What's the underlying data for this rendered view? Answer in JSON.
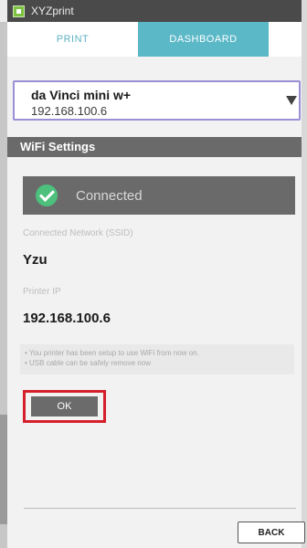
{
  "window": {
    "title": "XYZprint"
  },
  "tabs": [
    {
      "label": "PRINT",
      "active": false
    },
    {
      "label": "DASHBOARD",
      "active": true
    }
  ],
  "printer_select": {
    "name": "da Vinci mini w+",
    "ip": "192.168.100.6"
  },
  "wifi_settings": {
    "header": "WiFi Settings",
    "status": "Connected",
    "ssid_label": "Connected Network (SSID)",
    "ssid_value": "Yzu",
    "printer_ip_label": "Printer IP",
    "printer_ip_value": "192.168.100.6",
    "notes": [
      "• You printer has been setup to use WiFi from now on.",
      "• USB cable can be safely remove now"
    ],
    "ok_label": "OK"
  },
  "footer": {
    "back_label": "BACK"
  },
  "colors": {
    "accent": "#5bb8c7",
    "success": "#4ec07d",
    "highlight_outline": "#d61f2b",
    "section_bar": "#6a6a6a"
  },
  "icons": {
    "app": "xyzprint-app-icon",
    "status": "check-circle-icon",
    "dropdown": "dropdown-triangle-icon"
  }
}
